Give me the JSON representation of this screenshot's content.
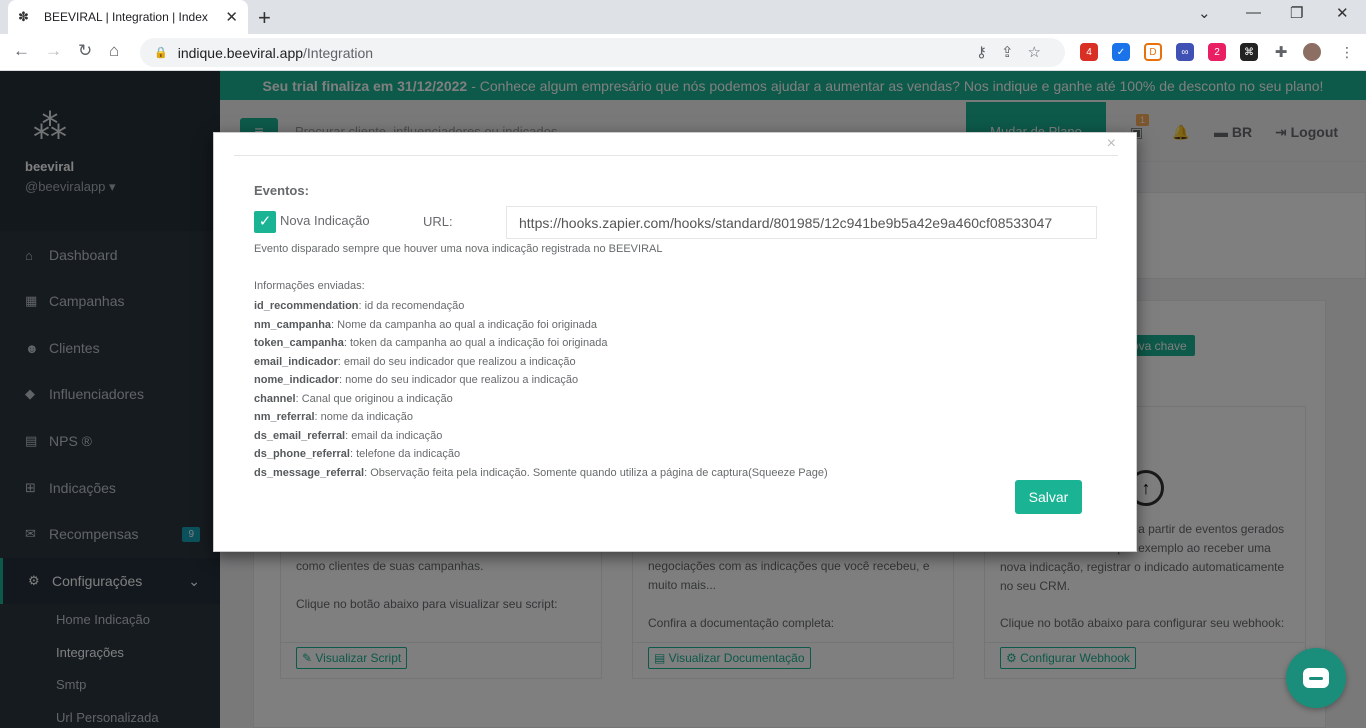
{
  "browser": {
    "tab_title": "BEEVIRAL | Integration | Index",
    "url_host": "indique.beeviral.app",
    "url_path": "/Integration",
    "ext_badge_1": "4",
    "ext_badge_2": "2"
  },
  "trial": {
    "strong": "Seu trial finaliza em 31/12/2022",
    "text": "- Conhece algum empresário que nós podemos ajudar a aumentar as vendas? Nos indique e ganhe até 100% de desconto no seu plano!"
  },
  "sidebar": {
    "brand_name": "beeviral",
    "handle": "@beeviralapp",
    "items": [
      {
        "label": "Dashboard"
      },
      {
        "label": "Campanhas"
      },
      {
        "label": "Clientes"
      },
      {
        "label": "Influenciadores"
      },
      {
        "label": "NPS ®"
      },
      {
        "label": "Indicações"
      },
      {
        "label": "Recompensas",
        "badge": "9"
      },
      {
        "label": "Configurações"
      }
    ],
    "submenu": [
      "Home Indicação",
      "Integrações",
      "Smtp",
      "Url Personalizada"
    ]
  },
  "topnav": {
    "search_placeholder": "Procurar cliente, influenciadores ou indicados...",
    "plan_button": "Mudar de Plano",
    "notif_count": "1",
    "lang": "BR",
    "logout": "Logout"
  },
  "background": {
    "new_key": "r nova chave",
    "card1_text": "como clientes de suas campanhas.",
    "card1_cta": "Clique no botão abaixo para visualizar seu script:",
    "card1_btn": "Visualizar Script",
    "card2_text": "negociações com as indicações que você recebeu, e muito mais...",
    "card2_cta": "Confira a documentação completa:",
    "card2_btn": "Visualizar Documentação",
    "card3_text": "rados para o seu sistema a partir de eventos gerados no BEEVIRAL. Como por exemplo ao receber uma nova indicação, registrar o indicado automaticamente no seu CRM.",
    "card3_cta": "Clique no botão abaixo para configurar seu webhook:",
    "card3_btn": "Configurar Webhook"
  },
  "modal": {
    "title": "Eventos:",
    "event_label": "Nova Indicação",
    "event_checked": true,
    "url_label": "URL:",
    "url_value": "https://hooks.zapier.com/hooks/standard/801985/12c941be9b5a42e9a460cf08533047",
    "hint": "Evento disparado sempre que houver uma nova indicação registrada no BEEVIRAL",
    "info_title": "Informações enviadas:",
    "fields": [
      {
        "key": "id_recommendation",
        "desc": ": id da recomendação"
      },
      {
        "key": "nm_campanha",
        "desc": ": Nome da campanha ao qual a indicação foi originada"
      },
      {
        "key": "token_campanha",
        "desc": ": token da campanha ao qual a indicação foi originada"
      },
      {
        "key": "email_indicador",
        "desc": ": email do seu indicador que realizou a indicação"
      },
      {
        "key": "nome_indicador",
        "desc": ": nome do seu indicador que realizou a indicação"
      },
      {
        "key": "channel",
        "desc": ": Canal que originou a indicação"
      },
      {
        "key": "nm_referral",
        "desc": ": nome da indicação"
      },
      {
        "key": "ds_email_referral",
        "desc": ": email da indicação"
      },
      {
        "key": "ds_phone_referral",
        "desc": ": telefone da indicação"
      },
      {
        "key": "ds_message_referral",
        "desc": ": Observação feita pela indicação. Somente quando utiliza a página de captura(Squeeze Page)"
      }
    ],
    "save_label": "Salvar",
    "close_glyph": "×"
  },
  "colors": {
    "accent": "#1ab394",
    "sidebar": "#2c3741",
    "chat": "#1b8e7b"
  }
}
